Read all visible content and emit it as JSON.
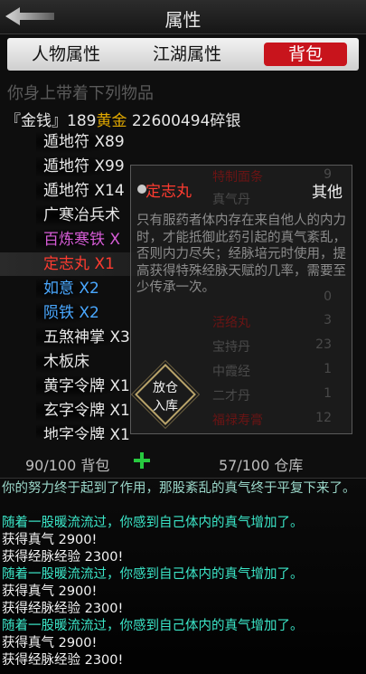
{
  "header": {
    "title": "属性",
    "back_icon": "back-arrow-icon"
  },
  "tabs": [
    {
      "label": "人物属性",
      "active": false
    },
    {
      "label": "江湖属性",
      "active": false
    },
    {
      "label": "背包",
      "active": true
    }
  ],
  "inventory": {
    "heading": "你身上带着下列物品",
    "money_prefix": "『金钱』189",
    "money_gold": "黄金",
    "money_silver": " 22600494碎银",
    "items": [
      {
        "label": "遁地符 X89",
        "color": "#e8e8e8"
      },
      {
        "label": "遁地符 X99",
        "color": "#e8e8e8"
      },
      {
        "label": "遁地符 X14",
        "color": "#e8e8e8"
      },
      {
        "label": "广寒冶兵术",
        "color": "#e8e8e8"
      },
      {
        "label": "百炼寒铁 X",
        "color": "#d65cd6"
      },
      {
        "label": "定志丸 X1",
        "color": "#ff3b30",
        "selected": true
      },
      {
        "label": "如意 X2",
        "color": "#4aa8ff"
      },
      {
        "label": "陨铁 X2",
        "color": "#4aa8ff"
      },
      {
        "label": "五煞神掌 X3",
        "color": "#e8e8e8"
      },
      {
        "label": "木板床",
        "color": "#e8e8e8"
      },
      {
        "label": "黄字令牌 X1",
        "color": "#e8e8e8"
      },
      {
        "label": "玄字令牌 X1",
        "color": "#e8e8e8"
      },
      {
        "label": "地字令牌 X1",
        "color": "#e8e8e8"
      }
    ],
    "bag_count": "90/100 背包",
    "warehouse_count": "57/100 仓库"
  },
  "popup": {
    "name": "定志丸",
    "category": "其他",
    "description": "只有服药者体内存在来自他人的内力时，才能抵御此药引起的真气紊乱，否则内力尽失；经脉培元时使用，提高获得特殊经脉天赋的几率，需要至少传承一次。",
    "store_button_line1": "放仓",
    "store_button_line2": "入库",
    "background_rows": [
      {
        "name": "特制面条",
        "qty": "9",
        "red": true
      },
      {
        "name": "真气丹",
        "qty": "",
        "red": false
      },
      {
        "name": "",
        "qty": "",
        "red": false
      },
      {
        "name": "",
        "qty": "",
        "red": false
      },
      {
        "name": "",
        "qty": "",
        "red": false
      },
      {
        "name": "",
        "qty": "0",
        "red": false
      },
      {
        "name": "活络丸",
        "qty": "3",
        "red": true
      },
      {
        "name": "宝持丹",
        "qty": "23",
        "red": false
      },
      {
        "name": "中霞经",
        "qty": "1",
        "red": false
      },
      {
        "name": "二才丹",
        "qty": "1",
        "red": false
      },
      {
        "name": "福禄寿膏",
        "qty": "12",
        "red": true
      }
    ]
  },
  "log": {
    "lines": [
      {
        "text": "你的努力终于起到了作用，那股紊乱的真气终于平复下来了。",
        "style": "wrap"
      },
      {
        "text": "随着一股暖流流过，你感到自己体内的真气增加了。",
        "style": "cyan"
      },
      {
        "text": "获得真气 2900!",
        "style": "white"
      },
      {
        "text": "获得经脉经验 2300!",
        "style": "white"
      },
      {
        "text": "随着一股暖流流过，你感到自己体内的真气增加了。",
        "style": "cyan"
      },
      {
        "text": "获得真气 2900!",
        "style": "white"
      },
      {
        "text": "获得经脉经验 2300!",
        "style": "white"
      },
      {
        "text": "随着一股暖流流过，你感到自己体内的真气增加了。",
        "style": "cyan"
      },
      {
        "text": "获得真气 2900!",
        "style": "white"
      },
      {
        "text": "获得经脉经验 2300!",
        "style": "white"
      }
    ]
  },
  "colors": {
    "accent_red": "#c8141c",
    "gold": "#e0a800",
    "cyan_log": "#3be6c8",
    "plus_green": "#27c93f"
  }
}
